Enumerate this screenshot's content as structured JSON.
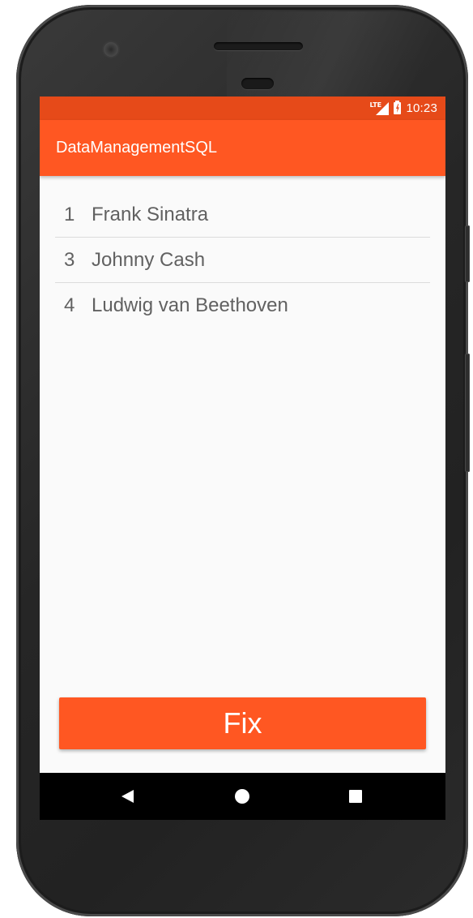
{
  "status_bar": {
    "network_label": "LTE",
    "time": "10:23",
    "icons": [
      "lte-signal-icon",
      "battery-charging-icon"
    ]
  },
  "app_bar": {
    "title": "DataManagementSQL"
  },
  "list": {
    "items": [
      {
        "id": "1",
        "name": "Frank Sinatra"
      },
      {
        "id": "3",
        "name": "Johnny Cash"
      },
      {
        "id": "4",
        "name": "Ludwig van Beethoven"
      }
    ]
  },
  "fix_button": {
    "label": "Fix"
  },
  "nav_bar": {
    "icons": [
      "back-icon",
      "home-icon",
      "recents-icon"
    ]
  },
  "colors": {
    "primary": "#ff5722",
    "primary_dark": "#e64a19",
    "background": "#fafafa",
    "list_text": "#616161"
  }
}
